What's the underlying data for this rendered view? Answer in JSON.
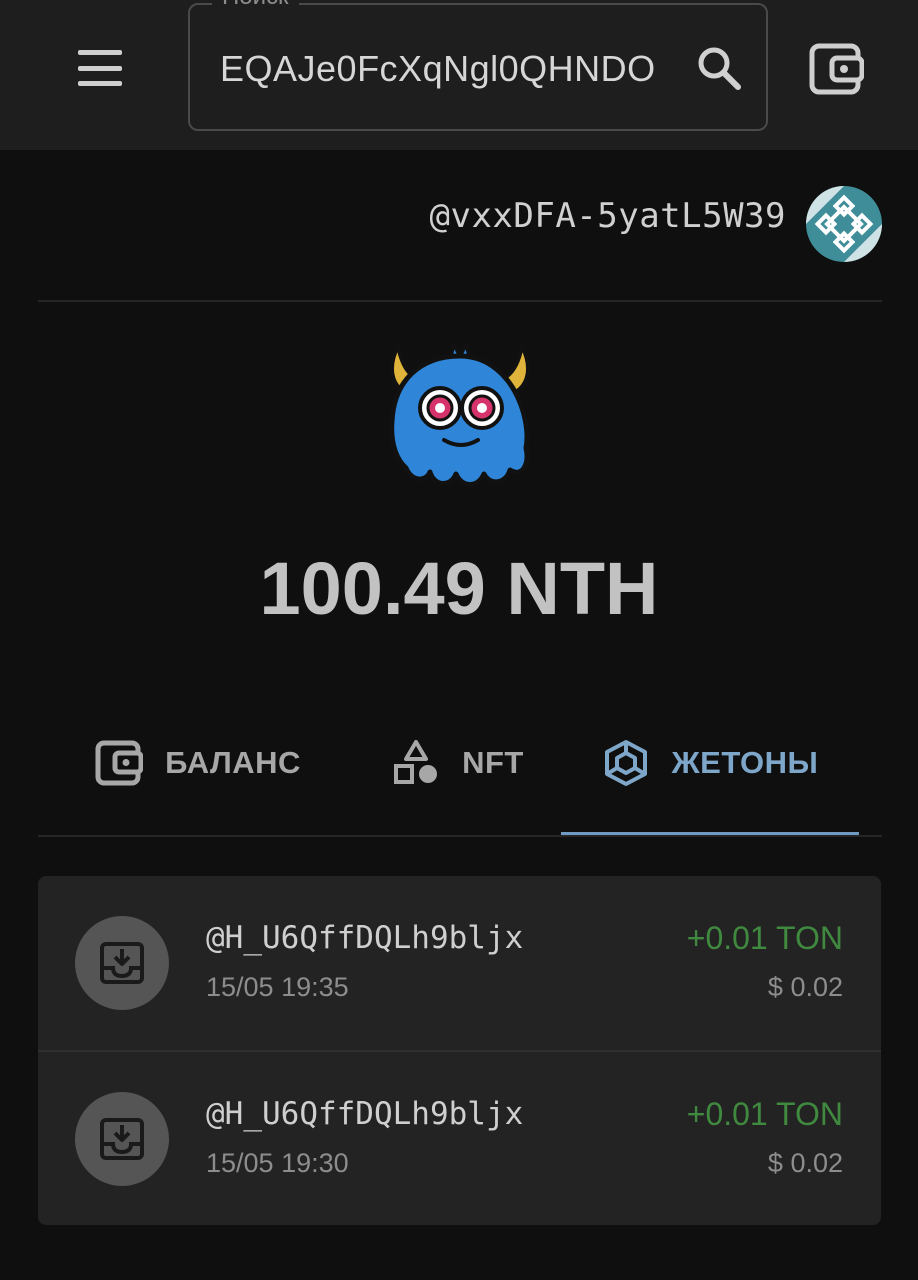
{
  "header": {
    "menu_icon": "hamburger-menu-icon",
    "search": {
      "legend": "Поиск",
      "value": "EQAJe0FcXqNgl0QHNDO",
      "icon": "search-icon"
    },
    "wallet_icon": "wallet-icon"
  },
  "account": {
    "name": "@vxxDFA-5yatL5W39",
    "avatar_icon": "geometric-avatar-icon"
  },
  "token": {
    "logo_icon": "blue-monster-token-icon",
    "balance": "100.49 NTH"
  },
  "tabs": [
    {
      "label": "БАЛАНС",
      "icon": "wallet-icon",
      "active": false
    },
    {
      "label": "NFT",
      "icon": "shapes-icon",
      "active": false
    },
    {
      "label": "ЖЕТОНЫ",
      "icon": "cube-icon",
      "active": true
    }
  ],
  "transactions": [
    {
      "address": "@H_U6QffDQLh9bljx",
      "time": "15/05 19:35",
      "amount": "+0.01 TON",
      "fiat": "$ 0.02",
      "icon": "inbox-download-icon"
    },
    {
      "address": "@H_U6QffDQLh9bljx",
      "time": "15/05 19:30",
      "amount": "+0.01 TON",
      "fiat": "$ 0.02",
      "icon": "inbox-download-icon"
    }
  ],
  "colors": {
    "accent": "#7ea6c9",
    "incoming": "#3f8a3f",
    "background": "#0f0f0f",
    "topbar": "#1e1e1e",
    "card": "#232323"
  }
}
